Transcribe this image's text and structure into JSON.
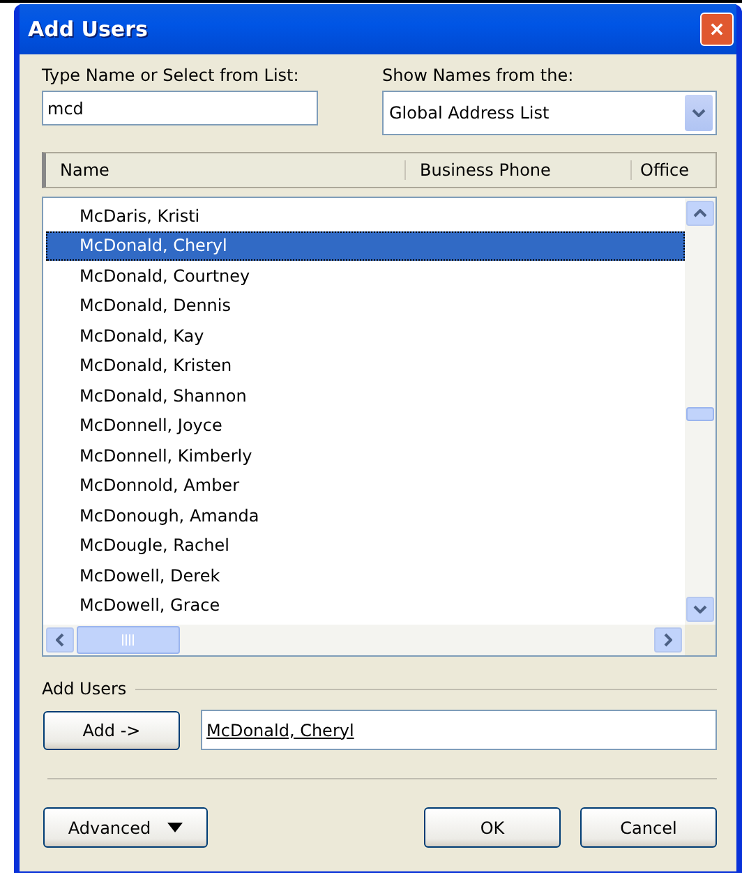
{
  "window": {
    "title": "Add Users"
  },
  "search": {
    "label": "Type Name or Select from List:",
    "value": "mcd"
  },
  "source": {
    "label": "Show Names from the:",
    "value": "Global Address List"
  },
  "table": {
    "columns": [
      "Name",
      "Business Phone",
      "Office"
    ],
    "rows": [
      {
        "name": "McDaris, Kristi",
        "selected": false
      },
      {
        "name": "McDonald, Cheryl",
        "selected": true
      },
      {
        "name": "McDonald, Courtney",
        "selected": false
      },
      {
        "name": "McDonald, Dennis",
        "selected": false
      },
      {
        "name": "McDonald, Kay",
        "selected": false
      },
      {
        "name": "McDonald, Kristen",
        "selected": false
      },
      {
        "name": "McDonald, Shannon",
        "selected": false
      },
      {
        "name": "McDonnell, Joyce",
        "selected": false
      },
      {
        "name": "McDonnell, Kimberly",
        "selected": false
      },
      {
        "name": "McDonnold, Amber",
        "selected": false
      },
      {
        "name": "McDonough, Amanda",
        "selected": false
      },
      {
        "name": "McDougle, Rachel",
        "selected": false
      },
      {
        "name": "McDowell, Derek",
        "selected": false
      },
      {
        "name": "McDowell, Grace",
        "selected": false
      }
    ]
  },
  "add_users": {
    "label": "Add Users",
    "button": "Add ->",
    "value": "McDonald, Cheryl"
  },
  "buttons": {
    "advanced": "Advanced",
    "ok": "OK",
    "cancel": "Cancel"
  }
}
